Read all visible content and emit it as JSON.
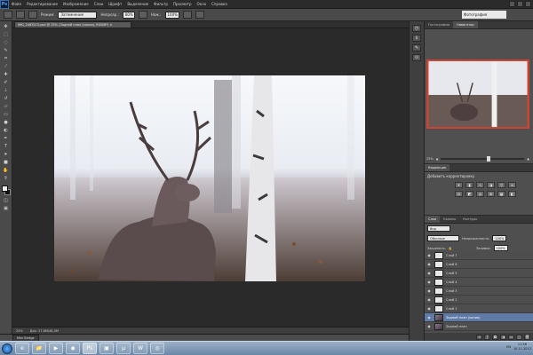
{
  "menubar": {
    "logo": "Ps",
    "items": [
      "Файл",
      "Редактирование",
      "Изображение",
      "Слои",
      "Шрифт",
      "Выделение",
      "Фильтр",
      "Просмотр",
      "Окно",
      "Справка"
    ]
  },
  "options": {
    "mode_label": "Режим:",
    "mode_value": "Затемнение",
    "opacity_label": "Непрозр.:",
    "opacity_value": "80%",
    "flow_label": "Наж.:",
    "flow_value": "100%",
    "workspace": "Фотография"
  },
  "document": {
    "tab_title": "IMG_2463215.psd @ 25% (Задний план (копия), RGB/8*) ×"
  },
  "status": {
    "zoom": "25%",
    "doc_info": "Док: 27,8М/46,4М"
  },
  "minibridge": {
    "tab": "Mini Bridge"
  },
  "panels": {
    "top_tabs": [
      "Гистограмма",
      "Навигатор"
    ],
    "nav_zoom": "25%",
    "adj_tabs": [
      "Коррекция"
    ],
    "adj_title": "Добавить корректировку",
    "layer_tabs": [
      "Слои",
      "Каналы",
      "Контуры"
    ],
    "kind_label": "Вид",
    "blend_value": "Обычные",
    "opacity_label": "Непрозрачность:",
    "opacity_value": "100%",
    "lock_label": "Закрепить:",
    "fill_label": "Заливка:",
    "fill_value": "100%"
  },
  "layers": [
    {
      "name": "Слой 7",
      "active": false
    },
    {
      "name": "Слой 6",
      "active": false
    },
    {
      "name": "Слой 5",
      "active": false
    },
    {
      "name": "Слой 4",
      "active": false
    },
    {
      "name": "Слой 3",
      "active": false
    },
    {
      "name": "Слой 2",
      "active": false
    },
    {
      "name": "Слой 1",
      "active": false
    },
    {
      "name": "Задний план (копия)",
      "active": true
    },
    {
      "name": "Задний план",
      "active": false
    }
  ],
  "taskbar": {
    "apps": [
      "e",
      "📁",
      "▶",
      "◉",
      "Ps",
      "▣",
      "μ",
      "W",
      "◎"
    ],
    "lang": "EN",
    "time": "11:56",
    "date": "10.11.2012"
  },
  "colors": {
    "accent": "#5f7aa6",
    "nav_frame": "#cc4433"
  }
}
